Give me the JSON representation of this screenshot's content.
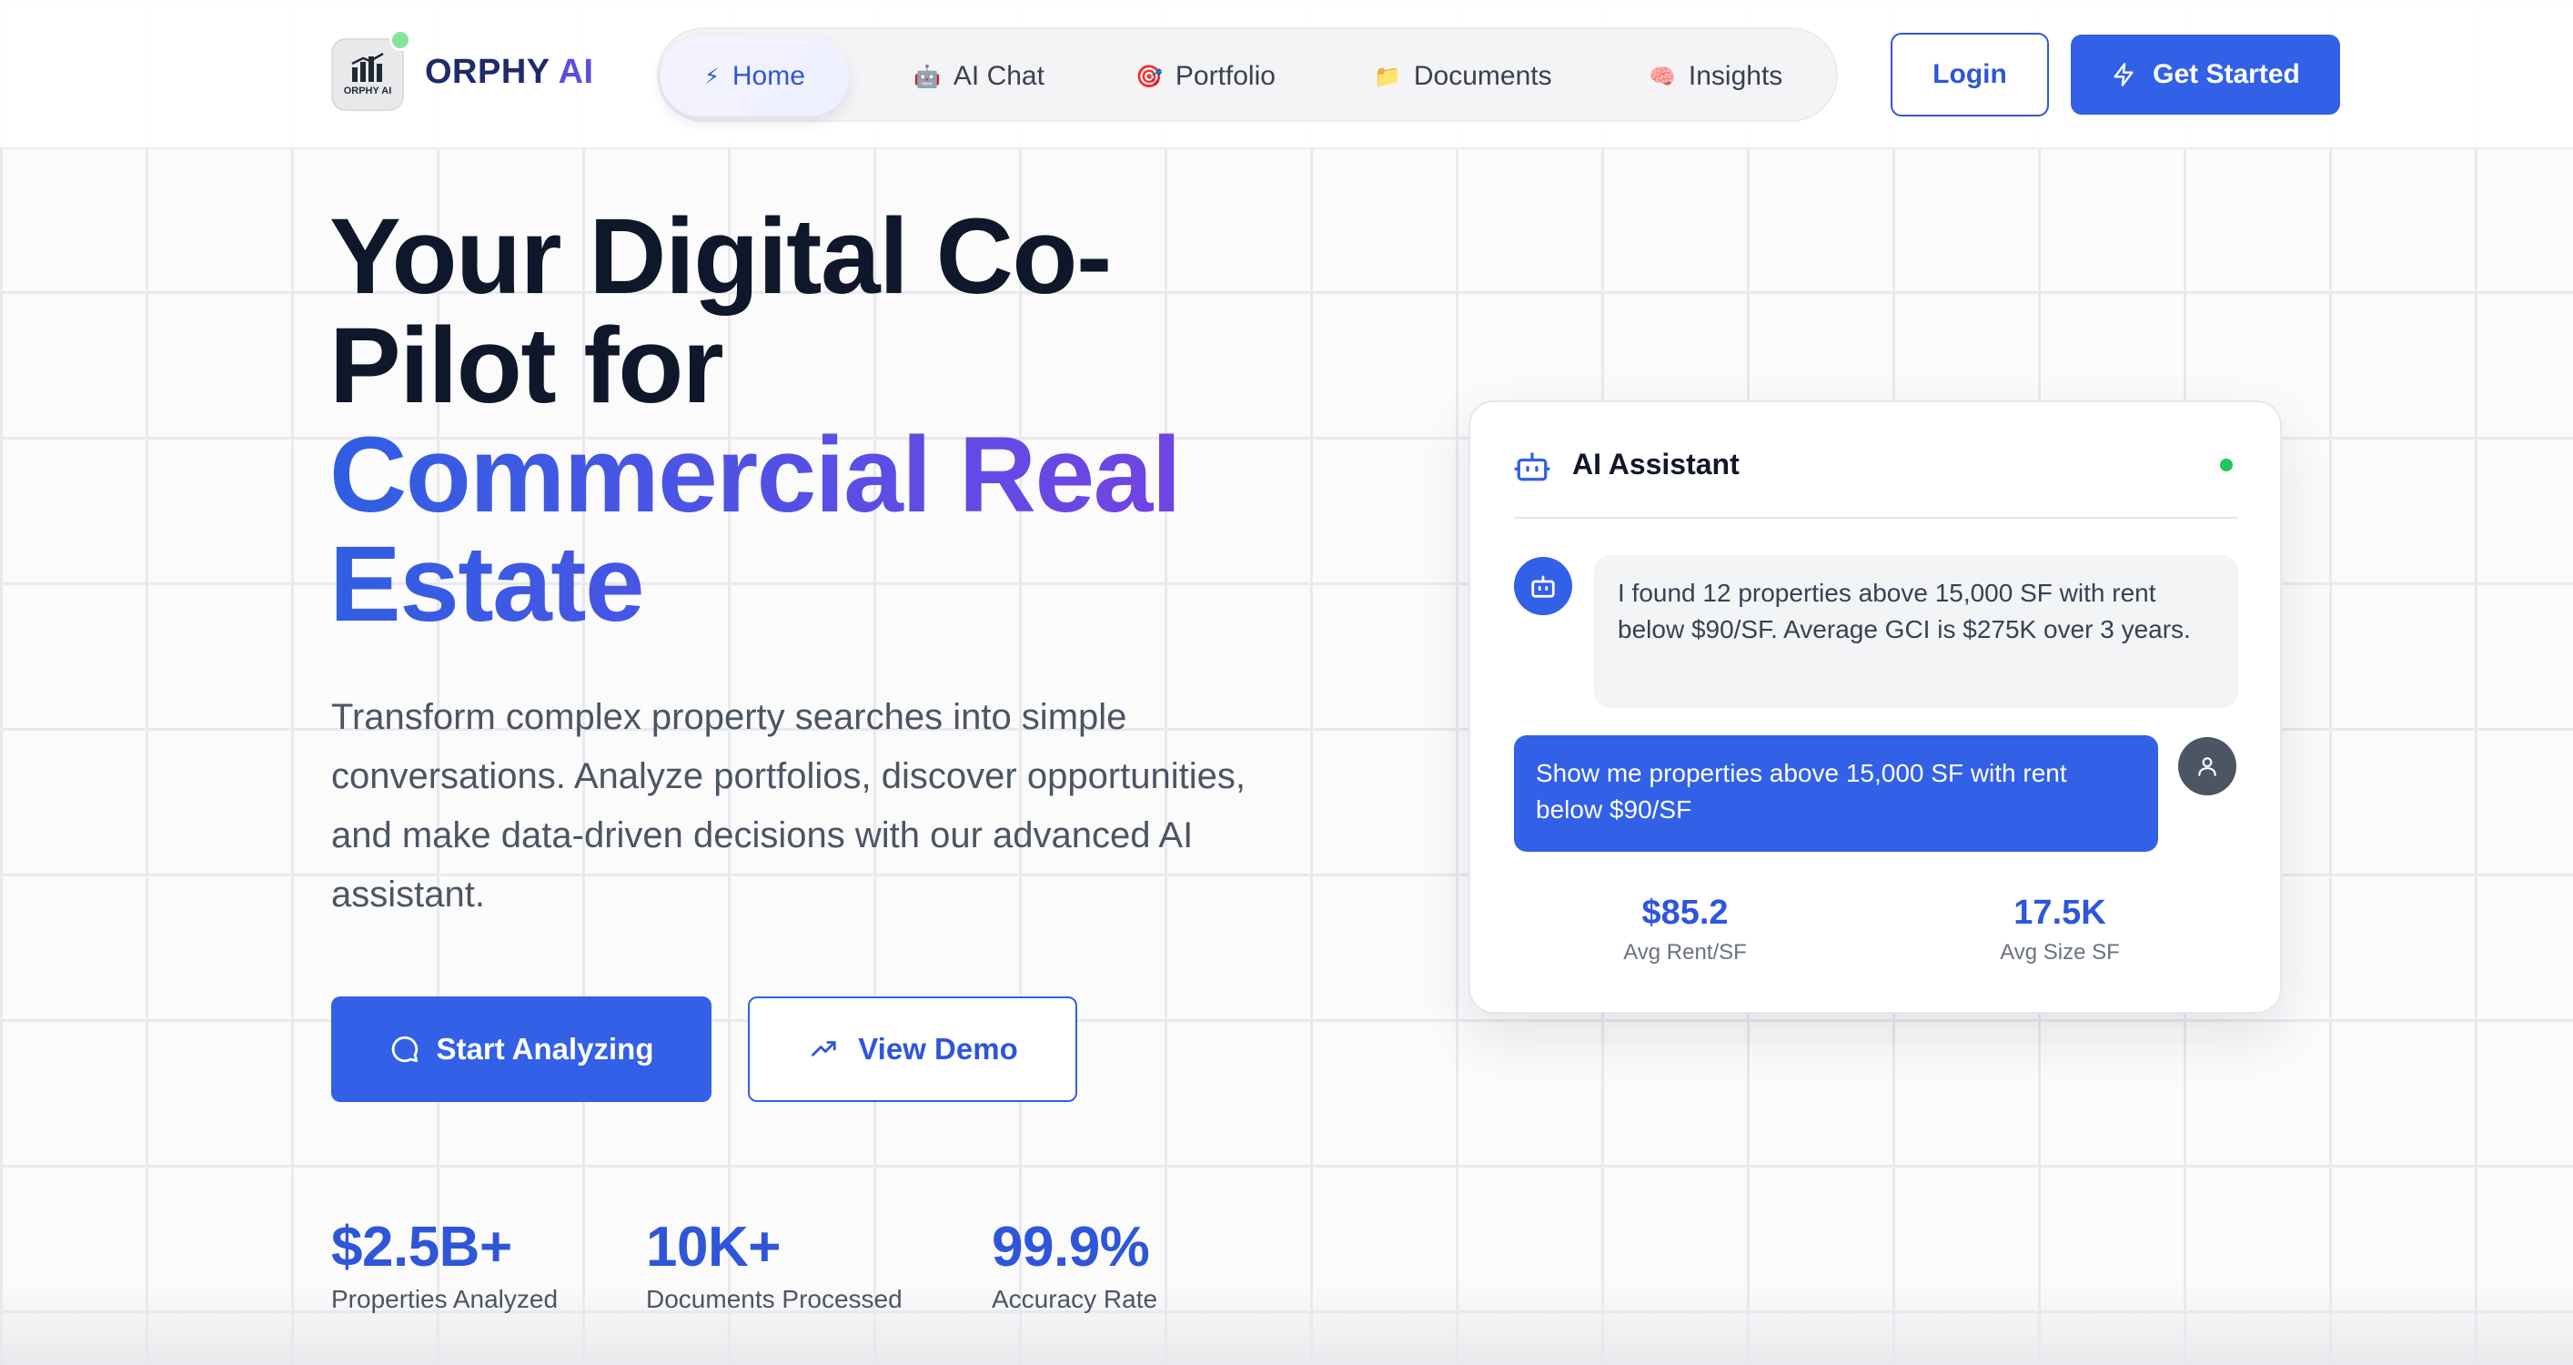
{
  "header": {
    "logo_text": "ORPHY AI",
    "brand_prefix": "ORPHY",
    "brand_suffix": "AI",
    "nav": [
      {
        "label": "Home",
        "icon": "lightning-icon",
        "glyph": "⚡",
        "active": true
      },
      {
        "label": "AI Chat",
        "icon": "robot-icon",
        "glyph": "🤖"
      },
      {
        "label": "Portfolio",
        "icon": "target-icon",
        "glyph": "🎯"
      },
      {
        "label": "Documents",
        "icon": "folder-icon",
        "glyph": "📁"
      },
      {
        "label": "Insights",
        "icon": "brain-icon",
        "glyph": "🧠"
      }
    ],
    "login_label": "Login",
    "get_started_label": "Get Started"
  },
  "hero": {
    "title_line1": "Your Digital Co-",
    "title_line2": "Pilot for",
    "title_line3": "Commercial Real",
    "title_line4": "Estate",
    "description": "Transform complex property searches into simple conversations. Analyze portfolios, discover opportunities, and make data-driven decisions with our advanced AI assistant.",
    "primary_cta": "Start Analyzing",
    "secondary_cta": "View Demo",
    "stats": [
      {
        "value": "$2.5B+",
        "label": "Properties Analyzed"
      },
      {
        "value": "10K+",
        "label": "Documents Processed"
      },
      {
        "value": "99.9%",
        "label": "Accuracy Rate"
      }
    ]
  },
  "assistant_card": {
    "title": "AI Assistant",
    "bot_message": "I found 12 properties above 15,000 SF with rent below $90/SF. Average GCI is $275K over 3 years.",
    "user_message": "Show me properties above 15,000 SF with rent below $90/SF",
    "stats": [
      {
        "value": "$85.2",
        "label": "Avg Rent/SF"
      },
      {
        "value": "17.5K",
        "label": "Avg Size SF"
      }
    ]
  },
  "colors": {
    "primary": "#3260e6",
    "gradient_start": "#2f5fe3",
    "gradient_end": "#7b3fe4",
    "online": "#22c55e"
  }
}
